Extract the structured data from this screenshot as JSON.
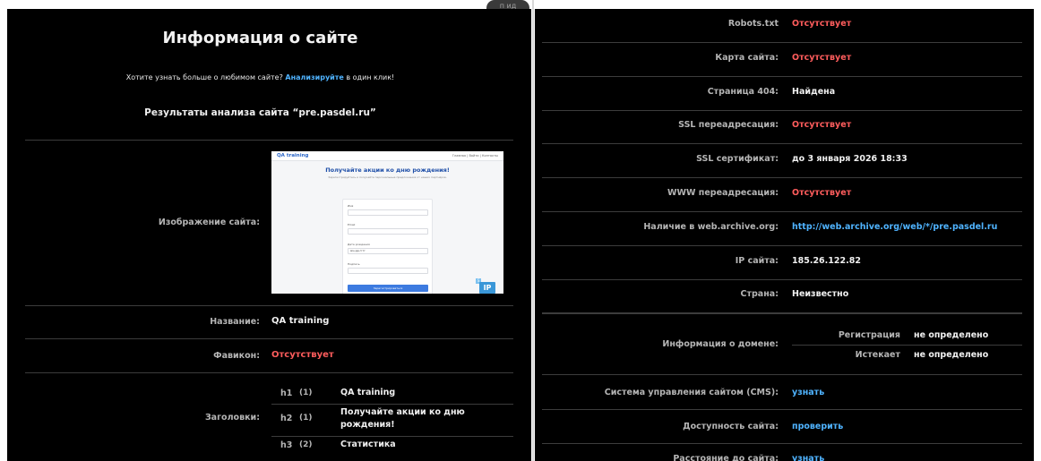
{
  "top_tab": "п ид",
  "left": {
    "title": "Информация о сайте",
    "intro_prefix": "Хотите узнать больше о любимом сайте?",
    "intro_link": "Анализируйте",
    "intro_suffix": "в один клик!",
    "results_title": "Результаты анализа сайта “pre.pasdel.ru”",
    "image_label": "Изображение сайта:",
    "name_label": "Название:",
    "name_value": "QA training",
    "favicon_label": "Фавикон:",
    "favicon_value": "Отсутствует",
    "headings_label": "Заголовки:",
    "headings": [
      {
        "tag": "h1",
        "count": "(1)",
        "text": "QA training"
      },
      {
        "tag": "h2",
        "count": "(1)",
        "text": "Получайте акции ко дню рождения!"
      },
      {
        "tag": "h3",
        "count": "(2)",
        "text": "Статистика"
      }
    ]
  },
  "thumbnail": {
    "logo": "QA training",
    "nav": "Главная | Войти | Контакты",
    "heading": "Получайте акции ко дню рождения!",
    "subtext": "Зарегистрируйтесь и получайте персональные предложения от наших партнёров.",
    "fields": [
      "Имя",
      "Email",
      "Дата рождения",
      "Подпись"
    ],
    "date_placeholder": "мм.дд.гггг",
    "button": "Зарегистрироваться",
    "badge": "IP",
    "badge_small": "S"
  },
  "right": {
    "rows": [
      {
        "label": "Robots.txt",
        "value": "Отсутствует",
        "color": "red"
      },
      {
        "label": "Карта сайта:",
        "value": "Отсутствует",
        "color": "red"
      },
      {
        "label": "Страница 404:",
        "value": "Найдена",
        "color": "white"
      },
      {
        "label": "SSL переадресация:",
        "value": "Отсутствует",
        "color": "red"
      },
      {
        "label": "SSL сертификат:",
        "value": "до 3 января 2026 18:33",
        "color": "white"
      },
      {
        "label": "WWW переадресация:",
        "value": "Отсутствует",
        "color": "red"
      },
      {
        "label": "Наличие в web.archive.org:",
        "value": "http://web.archive.org/web/*/pre.pasdel.ru",
        "color": "blue"
      },
      {
        "label": "IP сайта:",
        "value": "185.26.122.82",
        "color": "white"
      },
      {
        "label": "Страна:",
        "value": "Неизвестно",
        "color": "white"
      }
    ],
    "domain_label": "Информация о домене:",
    "domain_rows": [
      {
        "label": "Регистрация",
        "value": "не определено"
      },
      {
        "label": "Истекает",
        "value": "не определено"
      }
    ],
    "cms_label": "Система управления сайтом (CMS):",
    "cms_value": "узнать",
    "availability_label": "Доступность сайта:",
    "availability_value": "проверить",
    "distance_label": "Расстояние до сайта:",
    "distance_value": "узнать"
  },
  "colors": {
    "red": "#ff5d5d",
    "blue": "#4fb3ff",
    "white": "#f0f0f0"
  }
}
